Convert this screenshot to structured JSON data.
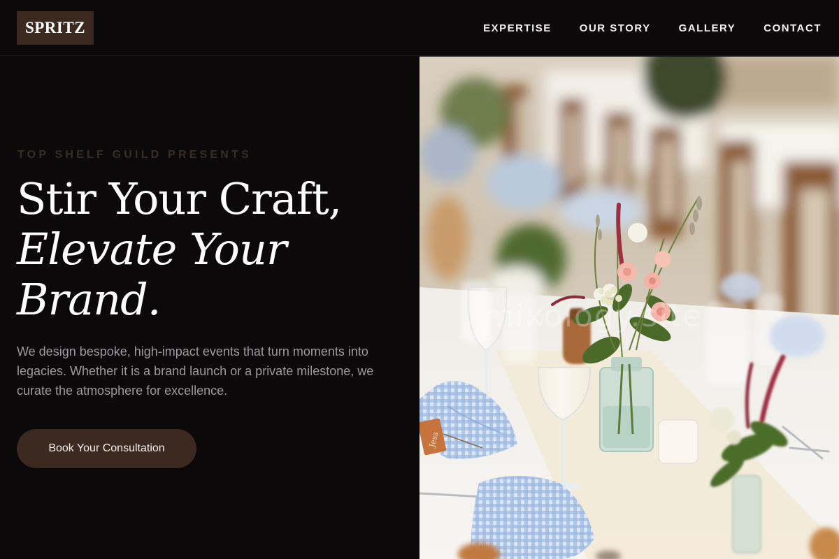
{
  "brand": {
    "logo_text": "SPRITZ"
  },
  "nav": {
    "items": [
      {
        "label": "EXPERTISE"
      },
      {
        "label": "OUR STORY"
      },
      {
        "label": "GALLERY"
      },
      {
        "label": "CONTACT"
      }
    ]
  },
  "hero": {
    "eyebrow": "TOP SHELF GUILD PRESENTS",
    "headline_line1": "Stir Your Craft,",
    "headline_line2": "Elevate Your",
    "headline_line3": "Brand.",
    "description": "We design bespoke, high-impact events that turn moments into legacies. Whether it is a brand launch or a private milestone, we curate the atmosphere for excellence.",
    "cta_label": "Book Your Consultation",
    "image_watermark": "mixology.site",
    "image_tag_text": "Jess"
  },
  "colors": {
    "background": "#0b0909",
    "accent_brown": "#3c2a21",
    "eyebrow_brown": "#3a2d26",
    "text_white": "#ffffff",
    "text_muted": "#9b9b9f"
  }
}
